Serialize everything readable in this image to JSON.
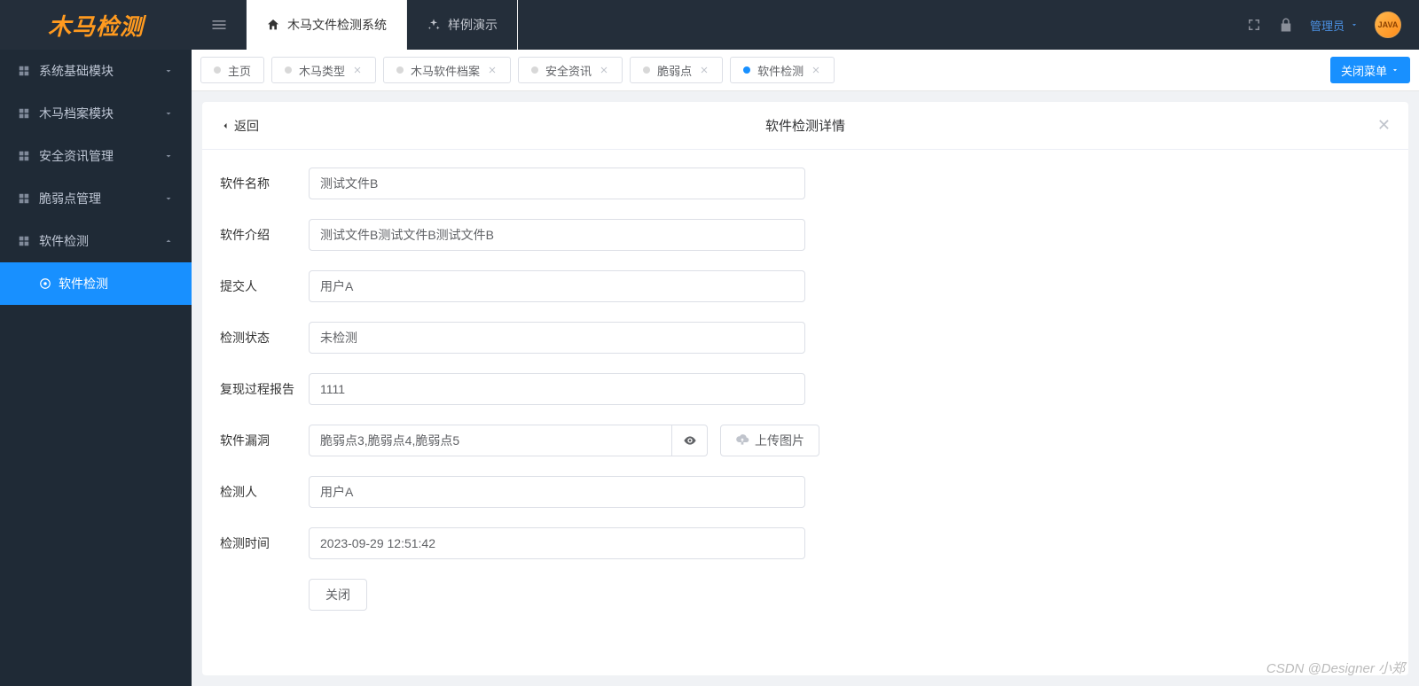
{
  "brand": "木马检测",
  "topnav": {
    "item1": "木马文件检测系统",
    "item2": "样例演示"
  },
  "user": {
    "label": "管理员",
    "avatar_text": "JAVA"
  },
  "sidebar": {
    "items": [
      {
        "label": "系统基础模块",
        "expanded": false
      },
      {
        "label": "木马档案模块",
        "expanded": false
      },
      {
        "label": "安全资讯管理",
        "expanded": false
      },
      {
        "label": "脆弱点管理",
        "expanded": false
      },
      {
        "label": "软件检测",
        "expanded": true
      }
    ],
    "sub_active": "软件检测"
  },
  "tabs": {
    "items": [
      {
        "label": "主页",
        "closable": false,
        "active": false
      },
      {
        "label": "木马类型",
        "closable": true,
        "active": false
      },
      {
        "label": "木马软件档案",
        "closable": true,
        "active": false
      },
      {
        "label": "安全资讯",
        "closable": true,
        "active": false
      },
      {
        "label": "脆弱点",
        "closable": true,
        "active": false
      },
      {
        "label": "软件检测",
        "closable": true,
        "active": true
      }
    ],
    "close_menu": "关闭菜单"
  },
  "panel": {
    "back": "返回",
    "title": "软件检测详情",
    "labels": {
      "name": "软件名称",
      "intro": "软件介绍",
      "submitter": "提交人",
      "status": "检测状态",
      "report": "复现过程报告",
      "vuln": "软件漏洞",
      "upload": "上传图片",
      "inspector": "检测人",
      "time": "检测时间"
    },
    "values": {
      "name": "测试文件B",
      "intro": "测试文件B测试文件B测试文件B",
      "submitter": "用户A",
      "status": "未检测",
      "report": "1111",
      "vuln": "脆弱点3,脆弱点4,脆弱点5",
      "inspector": "用户A",
      "time": "2023-09-29 12:51:42"
    },
    "close": "关闭"
  },
  "watermark": "CSDN @Designer 小郑"
}
